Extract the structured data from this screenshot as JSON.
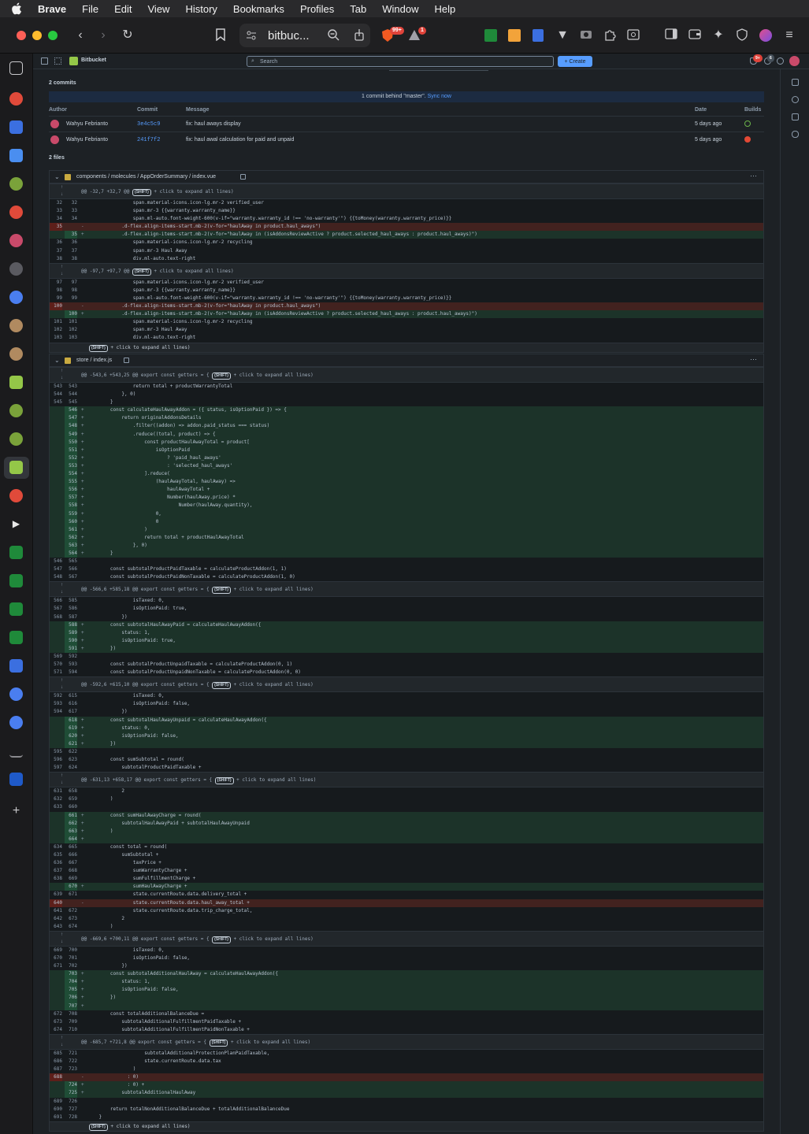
{
  "menubar": {
    "items": [
      "Brave",
      "File",
      "Edit",
      "View",
      "History",
      "Bookmarks",
      "Profiles",
      "Tab",
      "Window",
      "Help"
    ]
  },
  "browser": {
    "url_display": "bitbuc...",
    "shields_badge": "99+",
    "rewards_badge": "1"
  },
  "bitbucket": {
    "product_name": "Bitbucket",
    "search_placeholder": "Search",
    "create_label": "+ Create",
    "notif_badge": "9+",
    "help_badge": "6"
  },
  "commits": {
    "title": "2 commits",
    "behind_text": "1 commit behind \"master\".",
    "sync_label": "Sync now",
    "headers": {
      "author": "Author",
      "commit": "Commit",
      "message": "Message",
      "date": "Date",
      "builds": "Builds"
    },
    "rows": [
      {
        "author": "Wahyu Febrianto",
        "hash": "3e4c5c9",
        "message": "fix: haul aways display",
        "date": "5 days ago",
        "build": "success"
      },
      {
        "author": "Wahyu Febrianto",
        "hash": "241f7f2",
        "message": "fix: haul awal calculation for paid and unpaid",
        "date": "5 days ago",
        "build": "failed"
      }
    ]
  },
  "files_title": "2 files",
  "files": [
    {
      "path": "components / molecules / AppOrderSummary / index.vue",
      "blocks": [
        {
          "type": "hunk",
          "text": "@@ -32,7 +32,7 @@ ",
          "suffix": " + click to expand all lines)"
        },
        {
          "type": "ctx",
          "a": "32",
          "b": "32",
          "code": "                span.material-icons.icon-lg.mr-2 verified_user"
        },
        {
          "type": "ctx",
          "a": "33",
          "b": "33",
          "code": "                span.mr-3 {{warranty.warranty_name}}"
        },
        {
          "type": "ctx",
          "a": "34",
          "b": "34",
          "code": "                span.ml-auto.font-weight-600(v-if=\"warranty.warranty_id !== 'no-warranty'\") {{toMoney(warranty.warranty_price)}}"
        },
        {
          "type": "del",
          "a": "35",
          "b": "",
          "code": "            .d-flex.align-items-start.mb-2(v-for=\"haulAway in product.haul_aways\")"
        },
        {
          "type": "add",
          "a": "",
          "b": "35",
          "code": "            .d-flex.align-items-start.mb-2(v-for=\"haulAway in (isAddonsReviewActive ? product.selected_haul_aways : product.haul_aways)\")"
        },
        {
          "type": "ctx",
          "a": "36",
          "b": "36",
          "code": "                span.material-icons.icon-lg.mr-2 recycling"
        },
        {
          "type": "ctx",
          "a": "37",
          "b": "37",
          "code": "                span.mr-3 Haul Away"
        },
        {
          "type": "ctx",
          "a": "38",
          "b": "38",
          "code": "                div.ml-auto.text-right"
        },
        {
          "type": "hunk",
          "text": "@@ -97,7 +97,7 @@ ",
          "suffix": " + click to expand all lines)"
        },
        {
          "type": "ctx",
          "a": "97",
          "b": "97",
          "code": "                span.material-icons.icon-lg.mr-2 verified_user"
        },
        {
          "type": "ctx",
          "a": "98",
          "b": "98",
          "code": "                span.mr-3 {{warranty.warranty_name}}"
        },
        {
          "type": "ctx",
          "a": "99",
          "b": "99",
          "code": "                span.ml-auto.font-weight-600(v-if=\"warranty.warranty_id !== 'no-warranty'\") {{toMoney(warranty.warranty_price)}}"
        },
        {
          "type": "del",
          "a": "100",
          "b": "",
          "code": "            .d-flex.align-items-start.mb-2(v-for=\"haulAway in product.haul_aways\")"
        },
        {
          "type": "add",
          "a": "",
          "b": "100",
          "code": "            .d-flex.align-items-start.mb-2(v-for=\"haulAway in (isAddonsReviewActive ? product.selected_haul_aways : product.haul_aways)\")"
        },
        {
          "type": "ctx",
          "a": "101",
          "b": "101",
          "code": "                span.material-icons.icon-lg.mr-2 recycling"
        },
        {
          "type": "ctx",
          "a": "102",
          "b": "102",
          "code": "                span.mr-3 Haul Away"
        },
        {
          "type": "ctx",
          "a": "103",
          "b": "103",
          "code": "                div.ml-auto.text-right"
        },
        {
          "type": "end",
          "suffix": " + click to expand all lines)"
        }
      ]
    },
    {
      "path": "store / index.js",
      "blocks": [
        {
          "type": "hunk",
          "text": "@@ -543,6 +543,25 @@ export const getters = { ",
          "suffix": " + click to expand all lines)"
        },
        {
          "type": "ctx",
          "a": "543",
          "b": "543",
          "code": "                return total + productWarrantyTotal"
        },
        {
          "type": "ctx",
          "a": "544",
          "b": "544",
          "code": "            }, 0)"
        },
        {
          "type": "ctx",
          "a": "545",
          "b": "545",
          "code": "        }"
        },
        {
          "type": "add",
          "a": "",
          "b": "546",
          "code": "        const calculateHaulAwayAddon = ({ status, isOptionPaid }) => {"
        },
        {
          "type": "add",
          "a": "",
          "b": "547",
          "code": "            return originalAddonsDetails"
        },
        {
          "type": "add",
          "a": "",
          "b": "548",
          "code": "                .filter((addon) => addon.paid_status === status)"
        },
        {
          "type": "add",
          "a": "",
          "b": "549",
          "code": "                .reduce((total, product) => {"
        },
        {
          "type": "add",
          "a": "",
          "b": "550",
          "code": "                    const productHaulAwayTotal = product["
        },
        {
          "type": "add",
          "a": "",
          "b": "551",
          "code": "                        isOptionPaid"
        },
        {
          "type": "add",
          "a": "",
          "b": "552",
          "code": "                            ? 'paid_haul_aways'"
        },
        {
          "type": "add",
          "a": "",
          "b": "553",
          "code": "                            : 'selected_haul_aways'"
        },
        {
          "type": "add",
          "a": "",
          "b": "554",
          "code": "                    ].reduce("
        },
        {
          "type": "add",
          "a": "",
          "b": "555",
          "code": "                        (haulAwayTotal, haulAway) =>"
        },
        {
          "type": "add",
          "a": "",
          "b": "556",
          "code": "                            haulAwayTotal +"
        },
        {
          "type": "add",
          "a": "",
          "b": "557",
          "code": "                            Number(haulAway.price) *"
        },
        {
          "type": "add",
          "a": "",
          "b": "558",
          "code": "                                Number(haulAway.quantity),"
        },
        {
          "type": "add",
          "a": "",
          "b": "559",
          "code": "                        0,"
        },
        {
          "type": "add",
          "a": "",
          "b": "560",
          "code": "                        0"
        },
        {
          "type": "add",
          "a": "",
          "b": "561",
          "code": "                    )"
        },
        {
          "type": "add",
          "a": "",
          "b": "562",
          "code": "                    return total + productHaulAwayTotal"
        },
        {
          "type": "add",
          "a": "",
          "b": "563",
          "code": "                }, 0)"
        },
        {
          "type": "add",
          "a": "",
          "b": "564",
          "code": "        }"
        },
        {
          "type": "ctx",
          "a": "546",
          "b": "565",
          "code": ""
        },
        {
          "type": "ctx",
          "a": "547",
          "b": "566",
          "code": "        const subtotalProductPaidTaxable = calculateProductAddon(1, 1)"
        },
        {
          "type": "ctx",
          "a": "548",
          "b": "567",
          "code": "        const subtotalProductPaidNonTaxable = calculateProductAddon(1, 0)"
        },
        {
          "type": "hunk",
          "text": "@@ -566,6 +585,18 @@ export const getters = { ",
          "suffix": " + click to expand all lines)"
        },
        {
          "type": "ctx",
          "a": "566",
          "b": "585",
          "code": "                isTaxed: 0,"
        },
        {
          "type": "ctx",
          "a": "567",
          "b": "586",
          "code": "                isOptionPaid: true,"
        },
        {
          "type": "ctx",
          "a": "568",
          "b": "587",
          "code": "            })"
        },
        {
          "type": "add",
          "a": "",
          "b": "588",
          "code": "        const subtotalHaulAwayPaid = calculateHaulAwayAddon({"
        },
        {
          "type": "add",
          "a": "",
          "b": "589",
          "code": "            status: 1,"
        },
        {
          "type": "add",
          "a": "",
          "b": "590",
          "code": "            isOptionPaid: true,"
        },
        {
          "type": "add",
          "a": "",
          "b": "591",
          "code": "        })"
        },
        {
          "type": "ctx",
          "a": "569",
          "b": "592",
          "code": ""
        },
        {
          "type": "ctx",
          "a": "570",
          "b": "593",
          "code": "        const subtotalProductUnpaidTaxable = calculateProductAddon(0, 1)"
        },
        {
          "type": "ctx",
          "a": "571",
          "b": "594",
          "code": "        const subtotalProductUnpaidNonTaxable = calculateProductAddon(0, 0)"
        },
        {
          "type": "hunk",
          "text": "@@ -592,6 +615,10 @@ export const getters = { ",
          "suffix": " + click to expand all lines)"
        },
        {
          "type": "ctx",
          "a": "592",
          "b": "615",
          "code": "                isTaxed: 0,"
        },
        {
          "type": "ctx",
          "a": "593",
          "b": "616",
          "code": "                isOptionPaid: false,"
        },
        {
          "type": "ctx",
          "a": "594",
          "b": "617",
          "code": "            })"
        },
        {
          "type": "add",
          "a": "",
          "b": "618",
          "code": "        const subtotalHaulAwayUnpaid = calculateHaulAwayAddon({"
        },
        {
          "type": "add",
          "a": "",
          "b": "619",
          "code": "            status: 0,"
        },
        {
          "type": "add",
          "a": "",
          "b": "620",
          "code": "            isOptionPaid: false,"
        },
        {
          "type": "add",
          "a": "",
          "b": "621",
          "code": "        })"
        },
        {
          "type": "ctx",
          "a": "595",
          "b": "622",
          "code": ""
        },
        {
          "type": "ctx",
          "a": "596",
          "b": "623",
          "code": "        const sumSubtotal = round("
        },
        {
          "type": "ctx",
          "a": "597",
          "b": "624",
          "code": "            subtotalProductPaidTaxable +"
        },
        {
          "type": "hunk",
          "text": "@@ -631,13 +658,17 @@ export const getters = { ",
          "suffix": " + click to expand all lines)"
        },
        {
          "type": "ctx",
          "a": "631",
          "b": "658",
          "code": "            2"
        },
        {
          "type": "ctx",
          "a": "632",
          "b": "659",
          "code": "        )"
        },
        {
          "type": "ctx",
          "a": "633",
          "b": "660",
          "code": ""
        },
        {
          "type": "add",
          "a": "",
          "b": "661",
          "code": "        const sumHaulAwayCharge = round("
        },
        {
          "type": "add",
          "a": "",
          "b": "662",
          "code": "            subtotalHaulAwayPaid + subtotalHaulAwayUnpaid"
        },
        {
          "type": "add",
          "a": "",
          "b": "663",
          "code": "        )"
        },
        {
          "type": "add",
          "a": "",
          "b": "664",
          "code": ""
        },
        {
          "type": "ctx",
          "a": "634",
          "b": "665",
          "code": "        const total = round("
        },
        {
          "type": "ctx",
          "a": "635",
          "b": "666",
          "code": "            sumSubtotal +"
        },
        {
          "type": "ctx",
          "a": "636",
          "b": "667",
          "code": "                taxPrice +"
        },
        {
          "type": "ctx",
          "a": "637",
          "b": "668",
          "code": "                sumWarrantyCharge +"
        },
        {
          "type": "ctx",
          "a": "638",
          "b": "669",
          "code": "                sumFulfillmentCharge +"
        },
        {
          "type": "add",
          "a": "",
          "b": "670",
          "code": "                sumHaulAwayCharge +"
        },
        {
          "type": "ctx",
          "a": "639",
          "b": "671",
          "code": "                state.currentRoute.data.delivery_total +"
        },
        {
          "type": "del",
          "a": "640",
          "b": "",
          "code": "                state.currentRoute.data.haul_away_total +"
        },
        {
          "type": "ctx",
          "a": "641",
          "b": "672",
          "code": "                state.currentRoute.data.trip_charge_total,"
        },
        {
          "type": "ctx",
          "a": "642",
          "b": "673",
          "code": "            2"
        },
        {
          "type": "ctx",
          "a": "643",
          "b": "674",
          "code": "        )"
        },
        {
          "type": "hunk",
          "text": "@@ -669,6 +700,11 @@ export const getters = { ",
          "suffix": " + click to expand all lines)"
        },
        {
          "type": "ctx",
          "a": "669",
          "b": "700",
          "code": "                isTaxed: 0,"
        },
        {
          "type": "ctx",
          "a": "670",
          "b": "701",
          "code": "                isOptionPaid: false,"
        },
        {
          "type": "ctx",
          "a": "671",
          "b": "702",
          "code": "            })"
        },
        {
          "type": "add",
          "a": "",
          "b": "703",
          "code": "        const subtotalAdditionalHaulAway = calculateHaulAwayAddon({"
        },
        {
          "type": "add",
          "a": "",
          "b": "704",
          "code": "            status: 1,"
        },
        {
          "type": "add",
          "a": "",
          "b": "705",
          "code": "            isOptionPaid: false,"
        },
        {
          "type": "add",
          "a": "",
          "b": "706",
          "code": "        })"
        },
        {
          "type": "add",
          "a": "",
          "b": "707",
          "code": ""
        },
        {
          "type": "ctx",
          "a": "672",
          "b": "708",
          "code": "        const totalAdditionalBalanceDue ="
        },
        {
          "type": "ctx",
          "a": "673",
          "b": "709",
          "code": "            subtotalAdditionalFulfillmentPaidTaxable +"
        },
        {
          "type": "ctx",
          "a": "674",
          "b": "710",
          "code": "            subtotalAdditionalFulfillmentPaidNonTaxable +"
        },
        {
          "type": "hunk",
          "text": "@@ -685,7 +721,8 @@ export const getters = { ",
          "suffix": " + click to expand all lines)"
        },
        {
          "type": "ctx",
          "a": "685",
          "b": "721",
          "code": "                    subtotalAdditionalProtectionPlanPaidTaxable,"
        },
        {
          "type": "ctx",
          "a": "686",
          "b": "722",
          "code": "                    state.currentRoute.data.tax"
        },
        {
          "type": "ctx",
          "a": "687",
          "b": "723",
          "code": "                )"
        },
        {
          "type": "del",
          "a": "688",
          "b": "",
          "code": "              : 0)"
        },
        {
          "type": "add",
          "a": "",
          "b": "724",
          "code": "              : 0) +"
        },
        {
          "type": "add",
          "a": "",
          "b": "725",
          "code": "            subtotalAdditionalHaulAway"
        },
        {
          "type": "ctx",
          "a": "689",
          "b": "726",
          "code": ""
        },
        {
          "type": "ctx",
          "a": "690",
          "b": "727",
          "code": "        return totalNonAdditionalBalanceDue + totalAdditionalBalanceDue"
        },
        {
          "type": "ctx",
          "a": "691",
          "b": "728",
          "code": "    }"
        },
        {
          "type": "end",
          "suffix": " + click to expand all lines)"
        }
      ]
    }
  ],
  "kbd_label": "SHIFT",
  "colors": {
    "accent": "#579dff",
    "bitbucket_green": "#94c748",
    "added_bg": "#1c3329",
    "removed_bg": "#42221f"
  }
}
